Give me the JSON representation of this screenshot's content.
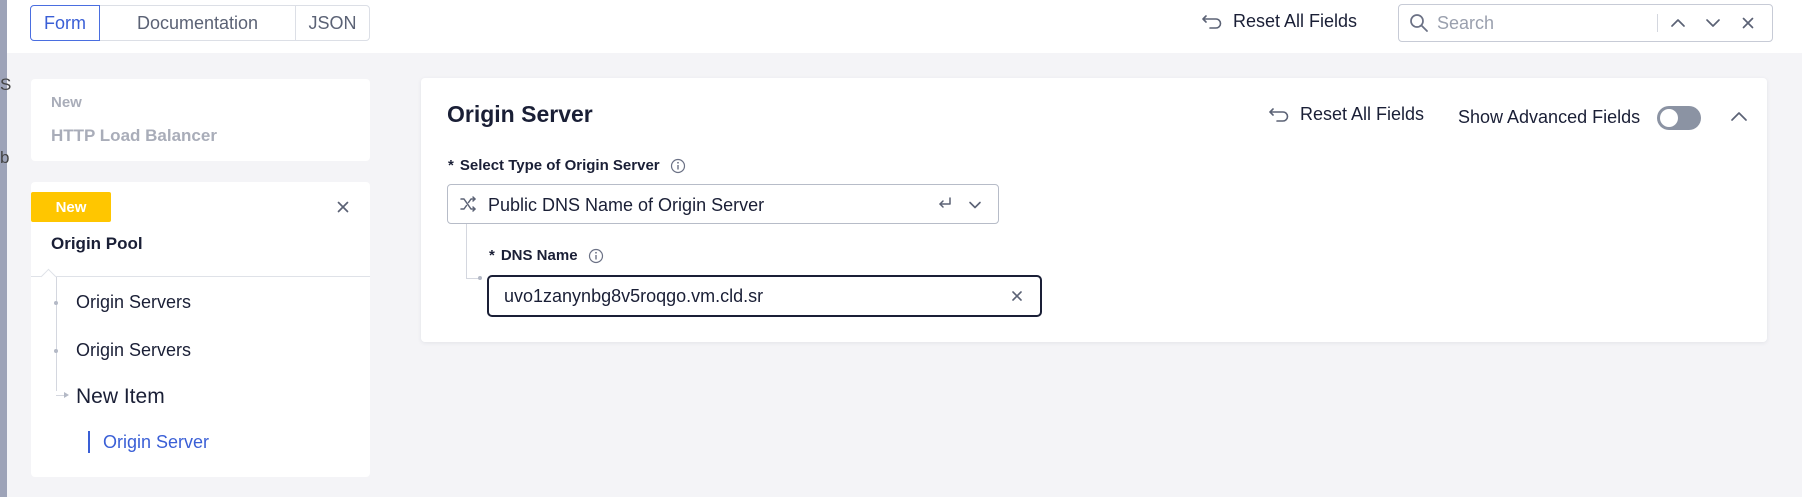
{
  "window": {
    "left_fragments": [
      "S",
      "b"
    ]
  },
  "toolbar": {
    "tabs": [
      {
        "label": "Form",
        "active": true
      },
      {
        "label": "Documentation",
        "active": false
      },
      {
        "label": "JSON",
        "active": false
      }
    ],
    "reset_label": "Reset All Fields",
    "search_placeholder": "Search",
    "search_value": ""
  },
  "sidebar": {
    "load_balancer": {
      "badge": "New",
      "title": "HTTP Load Balancer"
    },
    "origin_pool": {
      "badge": "New",
      "badge_color": "#ffc600",
      "title": "Origin Pool",
      "items": [
        "Origin Servers",
        "Origin Servers"
      ],
      "new_item": "New Item",
      "sub_item": "Origin Server"
    }
  },
  "panel": {
    "title": "Origin Server",
    "reset_label": "Reset All Fields",
    "advanced_label": "Show Advanced Fields",
    "advanced_enabled": false,
    "type_field": {
      "required_mark": "*",
      "label": "Select Type of Origin Server",
      "value": "Public DNS Name of Origin Server"
    },
    "dns_field": {
      "required_mark": "*",
      "label": "DNS Name",
      "value": "uvo1zanynbg8v5roqgo.vm.cld.sr"
    }
  },
  "colors": {
    "accent": "#3a5fd6",
    "text": "#1a1f36",
    "badge": "#ffc600",
    "toggle_off": "#8b93a3"
  }
}
